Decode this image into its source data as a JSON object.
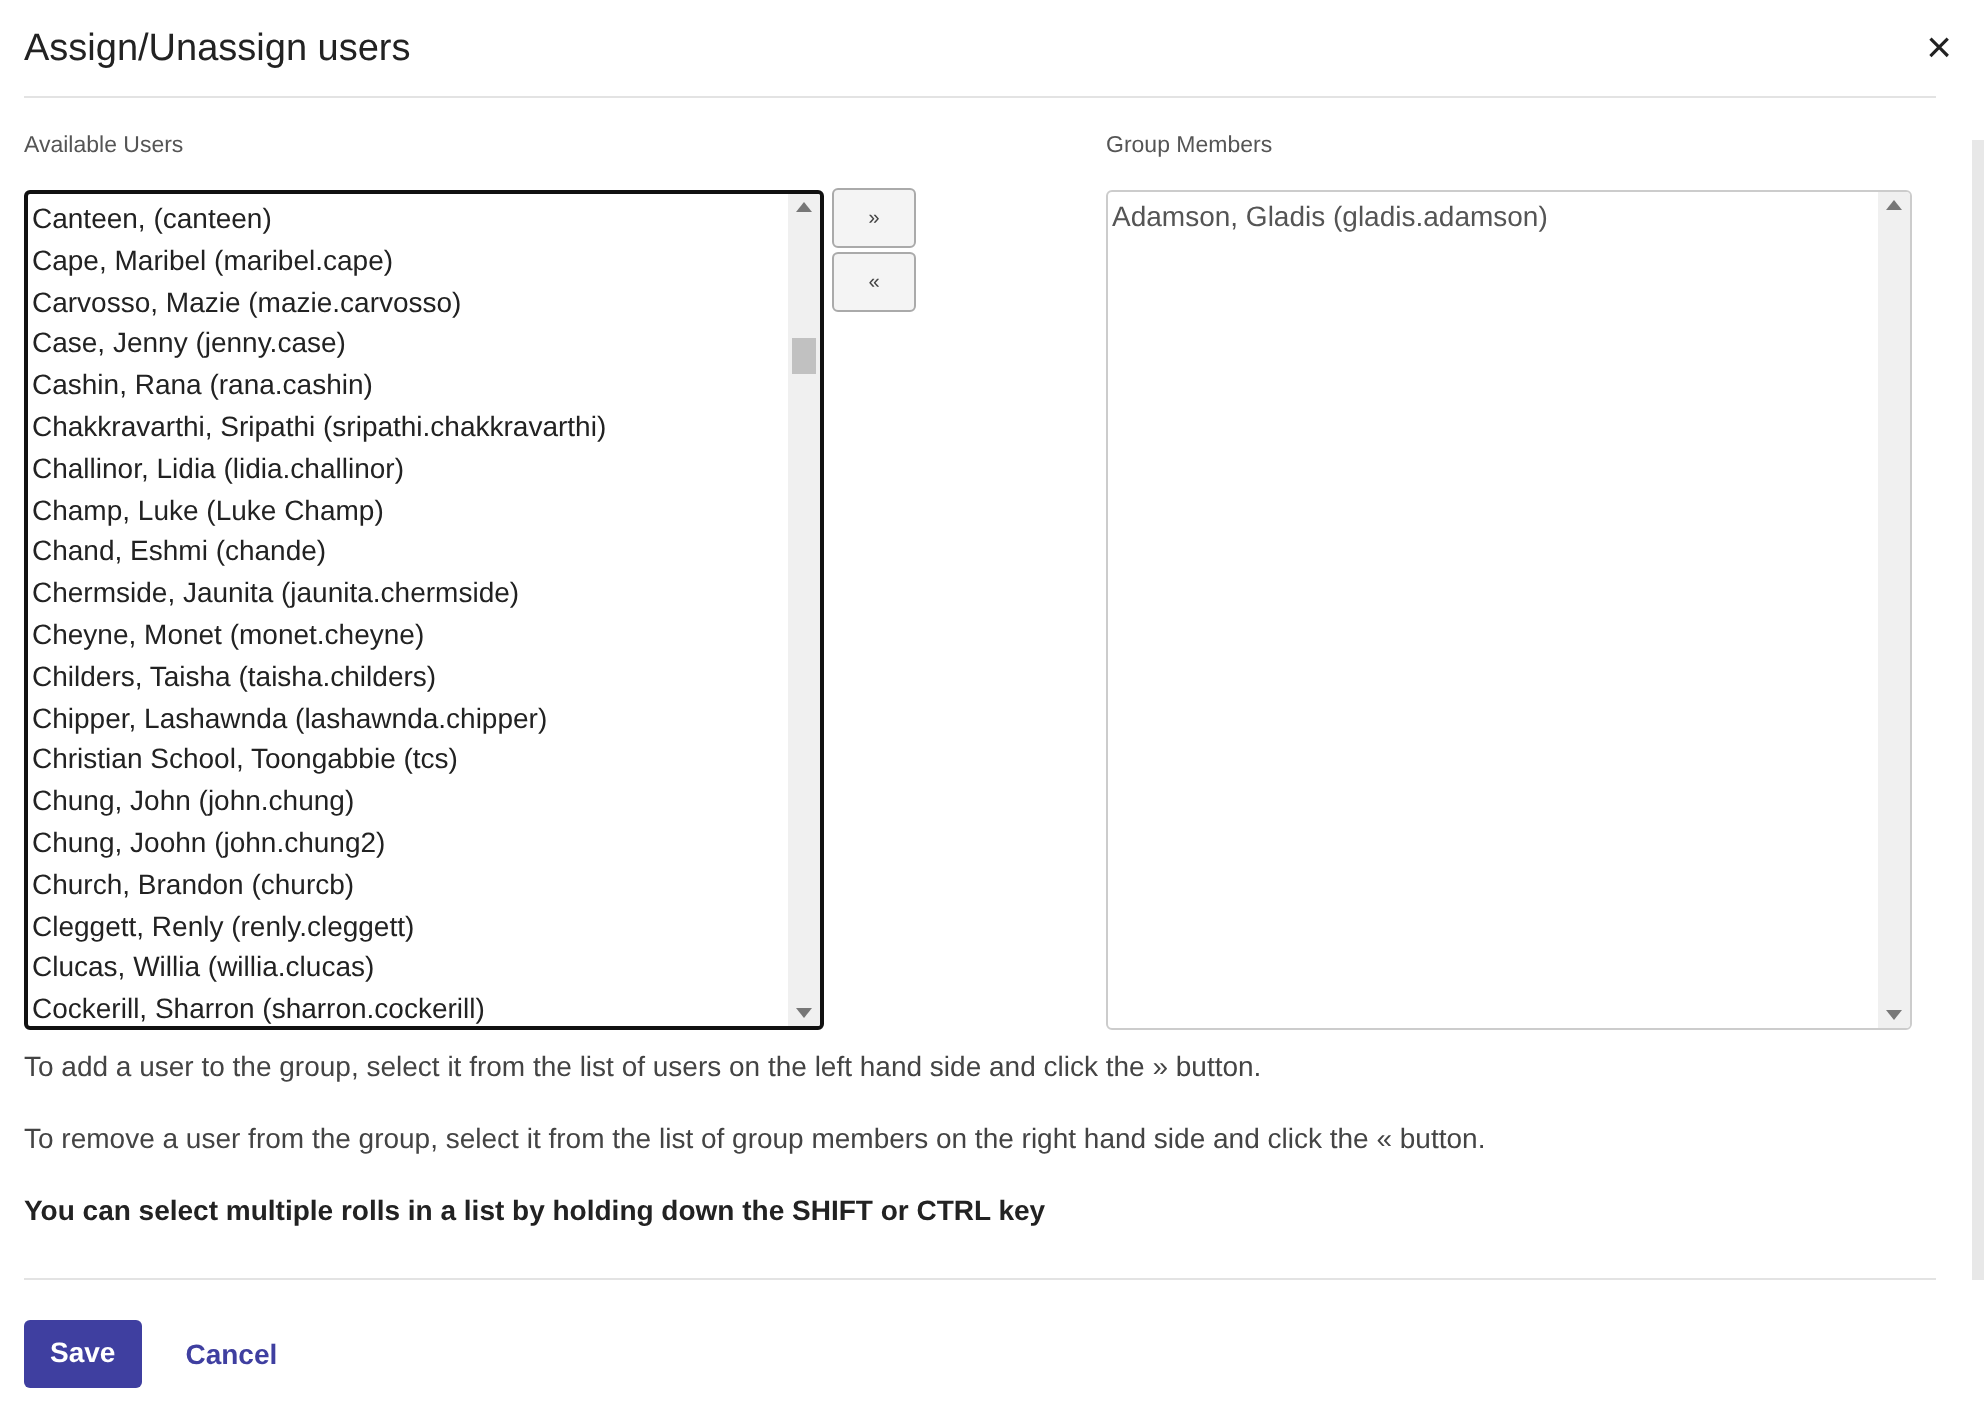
{
  "dialog": {
    "title": "Assign/Unassign users",
    "close": "×"
  },
  "available": {
    "label": "Available Users",
    "focused": true,
    "items": [
      "Canteen, (canteen)",
      "Cape, Maribel (maribel.cape)",
      "Carvosso, Mazie (mazie.carvosso)",
      "Case, Jenny (jenny.case)",
      "Cashin, Rana (rana.cashin)",
      "Chakkravarthi, Sripathi (sripathi.chakkravarthi)",
      "Challinor, Lidia (lidia.challinor)",
      "Champ, Luke (Luke Champ)",
      "Chand, Eshmi (chande)",
      "Chermside, Jaunita (jaunita.chermside)",
      "Cheyne, Monet (monet.cheyne)",
      "Childers, Taisha (taisha.childers)",
      "Chipper, Lashawnda (lashawnda.chipper)",
      "Christian School, Toongabbie (tcs)",
      "Chung, John (john.chung)",
      "Chung, Joohn (john.chung2)",
      "Church, Brandon (churcb)",
      "Cleggett, Renly (renly.cleggett)",
      "Clucas, Willia (willia.clucas)",
      "Cockerill, Sharron (sharron.cockerill)"
    ]
  },
  "move_buttons": [
    "»",
    "«"
  ],
  "members": {
    "label": "Group Members",
    "focused": false,
    "items": [
      "Adamson, Gladis (gladis.adamson)"
    ]
  },
  "help": [
    "To add a user to the group, select it from the list of users on the left hand side and click the » button.",
    "To remove a user from the group, select it from the list of group members on the right hand side and click the « button."
  ],
  "note": "You can select multiple rolls in a list by holding down the SHIFT or CTRL key",
  "buttons": {
    "save": "Save",
    "cancel": "Cancel"
  }
}
